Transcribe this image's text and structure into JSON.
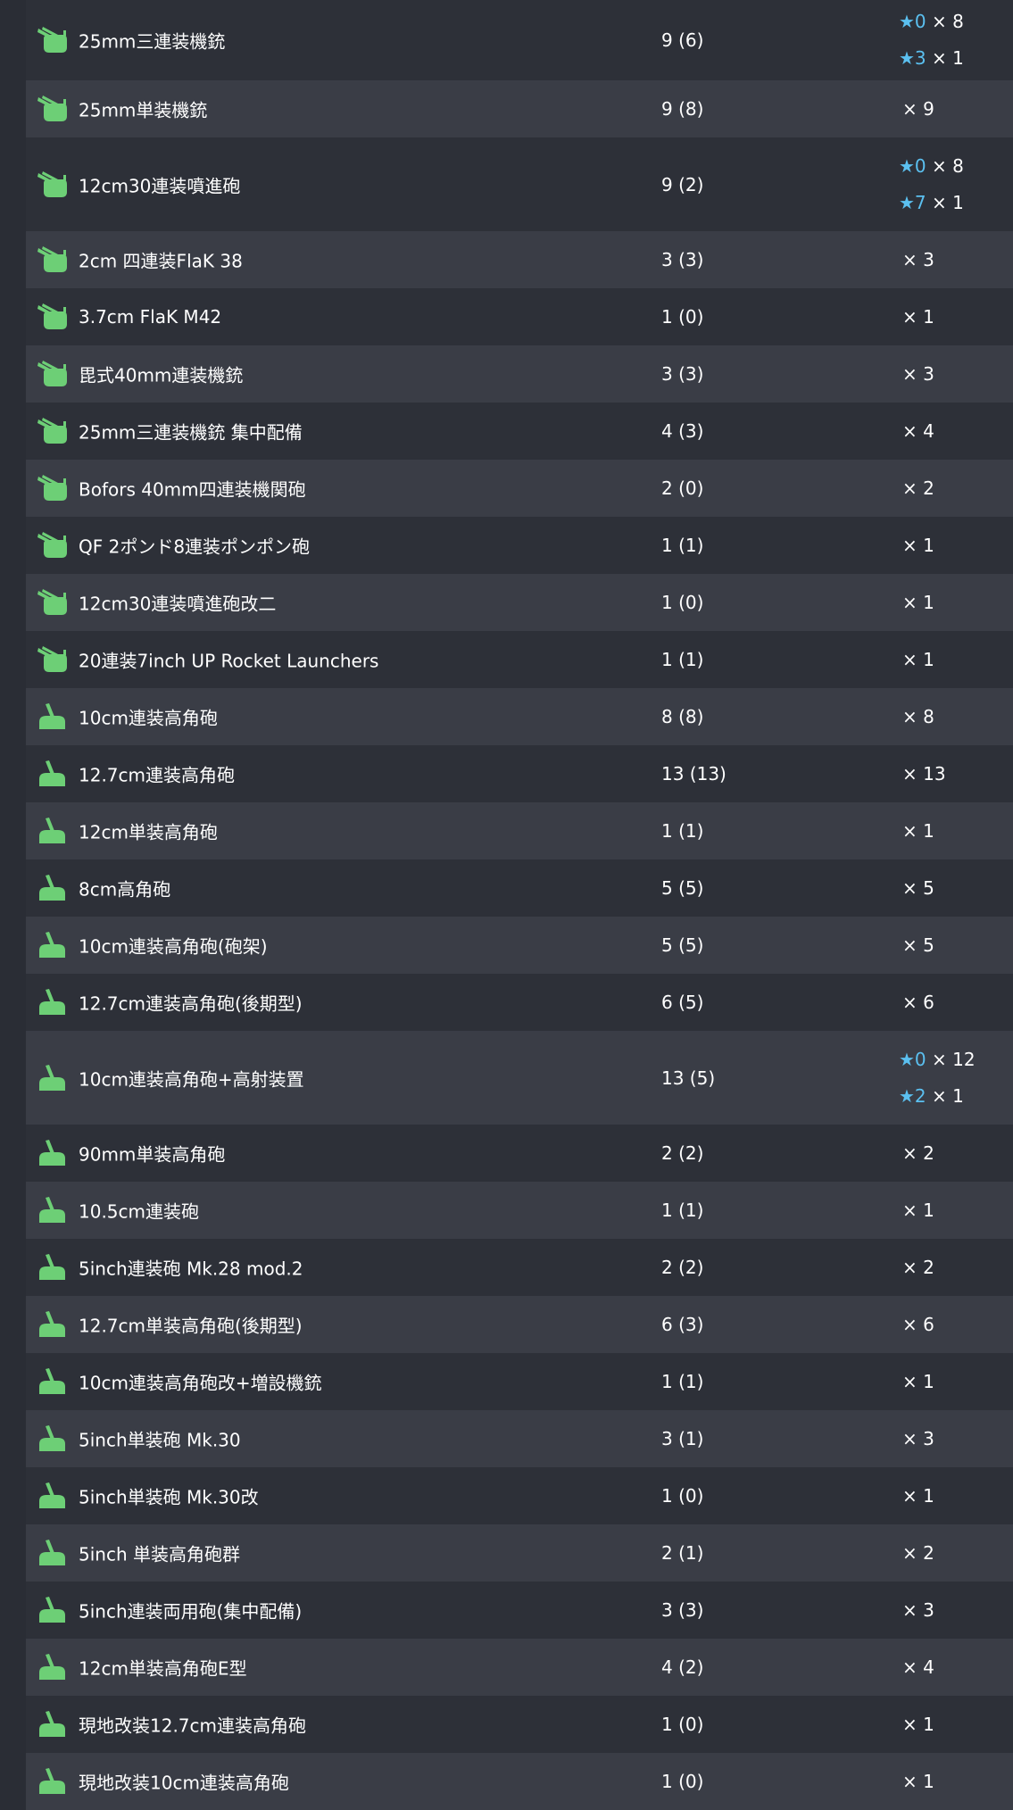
{
  "colors": {
    "background": "#2a2d35",
    "row_even": "#2d3038",
    "row_odd": "#3a3d46",
    "icon_green": "#6dcf76",
    "star_blue": "#5bc0f0",
    "text": "#ffffff"
  },
  "rows": [
    {
      "icon": "aa-gun-icon",
      "name": "25mm三連装機銃",
      "count": "9 (6)",
      "stars": [
        {
          "level": "★0",
          "qty": "× 8"
        },
        {
          "level": "★3",
          "qty": "× 1"
        }
      ]
    },
    {
      "icon": "aa-gun-icon",
      "name": "25mm単装機銃",
      "count": "9 (8)",
      "qty": "× 9"
    },
    {
      "icon": "aa-gun-icon",
      "name": "12cm30連装噴進砲",
      "count": "9 (2)",
      "stars": [
        {
          "level": "★0",
          "qty": "× 8"
        },
        {
          "level": "★7",
          "qty": "× 1"
        }
      ]
    },
    {
      "icon": "aa-gun-icon",
      "name": "2cm 四連装FlaK 38",
      "count": "3 (3)",
      "qty": "× 3"
    },
    {
      "icon": "aa-gun-icon",
      "name": "3.7cm FlaK M42",
      "count": "1 (0)",
      "qty": "× 1"
    },
    {
      "icon": "aa-gun-icon",
      "name": "毘式40mm連装機銃",
      "count": "3 (3)",
      "qty": "× 3"
    },
    {
      "icon": "aa-gun-icon",
      "name": "25mm三連装機銃 集中配備",
      "count": "4 (3)",
      "qty": "× 4"
    },
    {
      "icon": "aa-gun-icon",
      "name": "Bofors 40mm四連装機関砲",
      "count": "2 (0)",
      "qty": "× 2"
    },
    {
      "icon": "aa-gun-icon",
      "name": "QF 2ポンド8連装ポンポン砲",
      "count": "1 (1)",
      "qty": "× 1"
    },
    {
      "icon": "aa-gun-icon",
      "name": "12cm30連装噴進砲改二",
      "count": "1 (0)",
      "qty": "× 1"
    },
    {
      "icon": "aa-gun-icon",
      "name": "20連装7inch UP Rocket Launchers",
      "count": "1 (1)",
      "qty": "× 1"
    },
    {
      "icon": "ha-gun-icon",
      "name": "10cm連装高角砲",
      "count": "8 (8)",
      "qty": "× 8"
    },
    {
      "icon": "ha-gun-icon",
      "name": "12.7cm連装高角砲",
      "count": "13 (13)",
      "qty": "× 13"
    },
    {
      "icon": "ha-gun-icon",
      "name": "12cm単装高角砲",
      "count": "1 (1)",
      "qty": "× 1"
    },
    {
      "icon": "ha-gun-icon",
      "name": "8cm高角砲",
      "count": "5 (5)",
      "qty": "× 5"
    },
    {
      "icon": "ha-gun-icon",
      "name": "10cm連装高角砲(砲架)",
      "count": "5 (5)",
      "qty": "× 5"
    },
    {
      "icon": "ha-gun-icon",
      "name": "12.7cm連装高角砲(後期型)",
      "count": "6 (5)",
      "qty": "× 6"
    },
    {
      "icon": "ha-gun-icon",
      "name": "10cm連装高角砲+高射装置",
      "count": "13 (5)",
      "stars": [
        {
          "level": "★0",
          "qty": "× 12"
        },
        {
          "level": "★2",
          "qty": "× 1"
        }
      ]
    },
    {
      "icon": "ha-gun-icon",
      "name": "90mm単装高角砲",
      "count": "2 (2)",
      "qty": "× 2"
    },
    {
      "icon": "ha-gun-icon",
      "name": "10.5cm連装砲",
      "count": "1 (1)",
      "qty": "× 1"
    },
    {
      "icon": "ha-gun-icon",
      "name": "5inch連装砲 Mk.28 mod.2",
      "count": "2 (2)",
      "qty": "× 2"
    },
    {
      "icon": "ha-gun-icon",
      "name": "12.7cm単装高角砲(後期型)",
      "count": "6 (3)",
      "qty": "× 6"
    },
    {
      "icon": "ha-gun-icon",
      "name": "10cm連装高角砲改+増設機銃",
      "count": "1 (1)",
      "qty": "× 1"
    },
    {
      "icon": "ha-gun-icon",
      "name": "5inch単装砲 Mk.30",
      "count": "3 (1)",
      "qty": "× 3"
    },
    {
      "icon": "ha-gun-icon",
      "name": "5inch単装砲 Mk.30改",
      "count": "1 (0)",
      "qty": "× 1"
    },
    {
      "icon": "ha-gun-icon",
      "name": "5inch 単装高角砲群",
      "count": "2 (1)",
      "qty": "× 2"
    },
    {
      "icon": "ha-gun-icon",
      "name": "5inch連装両用砲(集中配備)",
      "count": "3 (3)",
      "qty": "× 3"
    },
    {
      "icon": "ha-gun-icon",
      "name": "12cm単装高角砲E型",
      "count": "4 (2)",
      "qty": "× 4"
    },
    {
      "icon": "ha-gun-icon",
      "name": "現地改装12.7cm連装高角砲",
      "count": "1 (0)",
      "qty": "× 1"
    },
    {
      "icon": "ha-gun-icon",
      "name": "現地改装10cm連装高角砲",
      "count": "1 (0)",
      "qty": "× 1"
    }
  ]
}
